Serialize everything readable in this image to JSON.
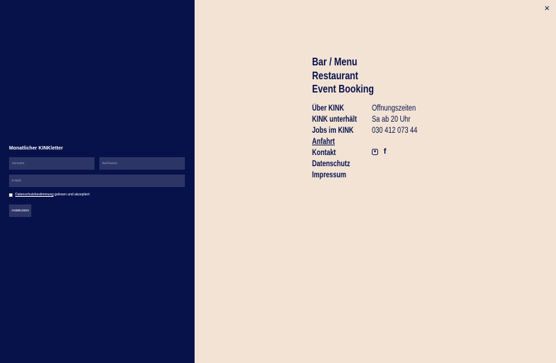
{
  "newsletter": {
    "title": "Monatlicher KINKletter",
    "first_name_placeholder": "Vorname",
    "last_name_placeholder": "Nachname",
    "email_placeholder": "E-Mail",
    "consent_link": "Datenschutzbestimmung",
    "consent_text": " gelesen und akzeptiert",
    "submit_label": "ANMELDEN"
  },
  "close_label": "×",
  "main_nav": [
    "Bar / Menu",
    "Restaurant",
    "Event Booking"
  ],
  "sub_nav": [
    "Über KINK",
    "KINK unterhält",
    "Jobs im KINK",
    "Anfahrt",
    "Kontakt",
    "Datenschutz",
    "Impressum"
  ],
  "active_sub_nav": "Anfahrt",
  "hours": {
    "title": "Öffnungszeiten",
    "time": "Sa ab 20 Uhr",
    "phone": "030 412 073 44"
  },
  "social": [
    "instagram-icon",
    "facebook-icon"
  ],
  "colors": {
    "navy": "#07114a",
    "cream": "#f2e3d5",
    "field": "#2d3566"
  }
}
